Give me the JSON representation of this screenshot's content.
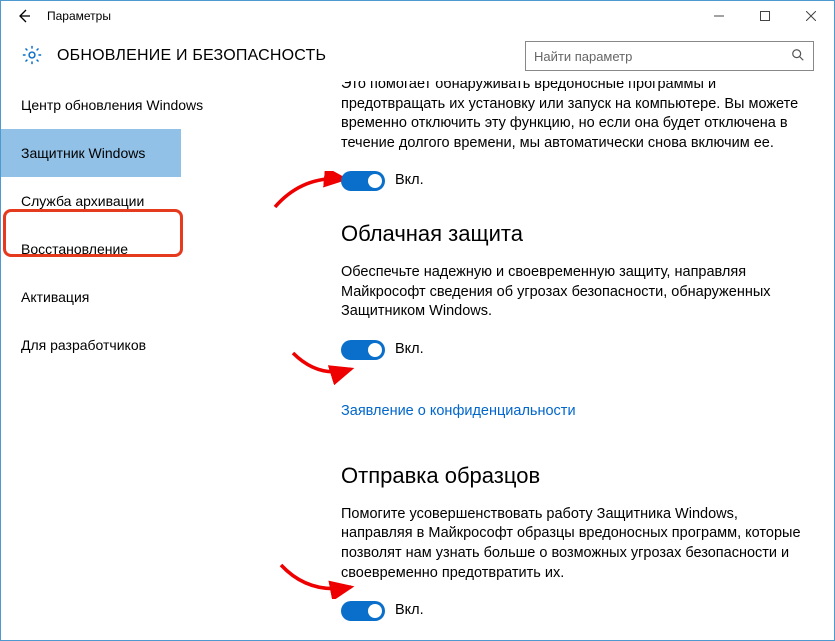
{
  "window_title": "Параметры",
  "page_heading": "ОБНОВЛЕНИЕ И БЕЗОПАСНОСТЬ",
  "search_placeholder": "Найти параметр",
  "sidebar": {
    "items": [
      {
        "label": "Центр обновления Windows"
      },
      {
        "label": "Защитник Windows"
      },
      {
        "label": "Служба архивации"
      },
      {
        "label": "Восстановление"
      },
      {
        "label": "Активация"
      },
      {
        "label": "Для разработчиков"
      }
    ],
    "selected_index": 1
  },
  "sections": {
    "realtime": {
      "desc_partial": "Это помогает обнаруживать вредоносные программы и предотвращать их установку или запуск на компьютере. Вы можете временно отключить эту функцию, но если она будет отключена в течение долгого времени, мы автоматически снова включим ее.",
      "state": "Вкл."
    },
    "cloud": {
      "title": "Облачная защита",
      "desc": "Обеспечьте надежную и своевременную защиту, направляя Майкрософт сведения об угрозах безопасности, обнаруженных Защитником Windows.",
      "state": "Вкл.",
      "privacy_link": "Заявление о конфиденциальности"
    },
    "samples": {
      "title": "Отправка образцов",
      "desc": "Помогите усовершенствовать работу Защитника Windows, направляя в Майкрософт образцы вредоносных программ, которые позволят нам узнать больше о возможных угрозах безопасности и своевременно предотвратить их.",
      "state": "Вкл."
    }
  }
}
